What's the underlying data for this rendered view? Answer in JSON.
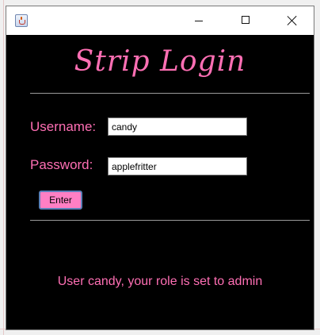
{
  "window": {
    "icon": "java-coffee-icon",
    "controls": {
      "minimize_icon": "minimize-icon",
      "maximize_icon": "maximize-icon",
      "close_icon": "close-icon"
    }
  },
  "login": {
    "title": "Strip Login",
    "username_label": "Username:",
    "username_value": "candy",
    "password_label": "Password:",
    "password_value": "applefritter",
    "enter_label": "Enter"
  },
  "status": {
    "message": "User candy, your role is set to admin"
  },
  "colors": {
    "accent": "#ff6fb4",
    "button": "#ff7fc4",
    "background": "#000000",
    "separator": "#9a9a9a"
  }
}
